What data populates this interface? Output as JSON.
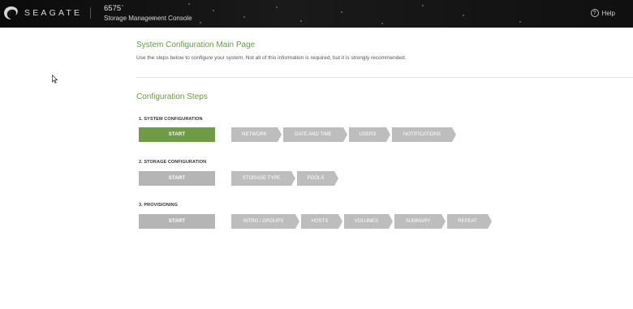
{
  "header": {
    "brand": "SEAGATE",
    "system_id": "6575",
    "system_name": "Storage Management Console",
    "help_label": "Help",
    "help_icon": "?"
  },
  "main": {
    "title": "System Configuration Main Page",
    "description": "Use the steps below to configure your system. Not all of this information is required, but it is strongly recommended.",
    "steps_title": "Configuration Steps",
    "steps": [
      {
        "label": "1. SYSTEM CONFIGURATION",
        "start_label": "START",
        "items": [
          "NETWORK",
          "DATE AND TIME",
          "USERS",
          "NOTIFICATIONS"
        ]
      },
      {
        "label": "2. STORAGE CONFIGURATION",
        "start_label": "START",
        "items": [
          "STORAGE TYPE",
          "POOLS"
        ]
      },
      {
        "label": "3. PROVISIONING",
        "start_label": "START",
        "items": [
          "INTRO / GROUPS",
          "HOSTS",
          "VOLUMES",
          "SUMMARY",
          "REPEAT"
        ]
      }
    ]
  },
  "colors": {
    "accent": "#6b9b41",
    "start_active": "#6f9b45",
    "start_inactive": "#b5b5b5",
    "chevron": "#bdbdbd"
  }
}
